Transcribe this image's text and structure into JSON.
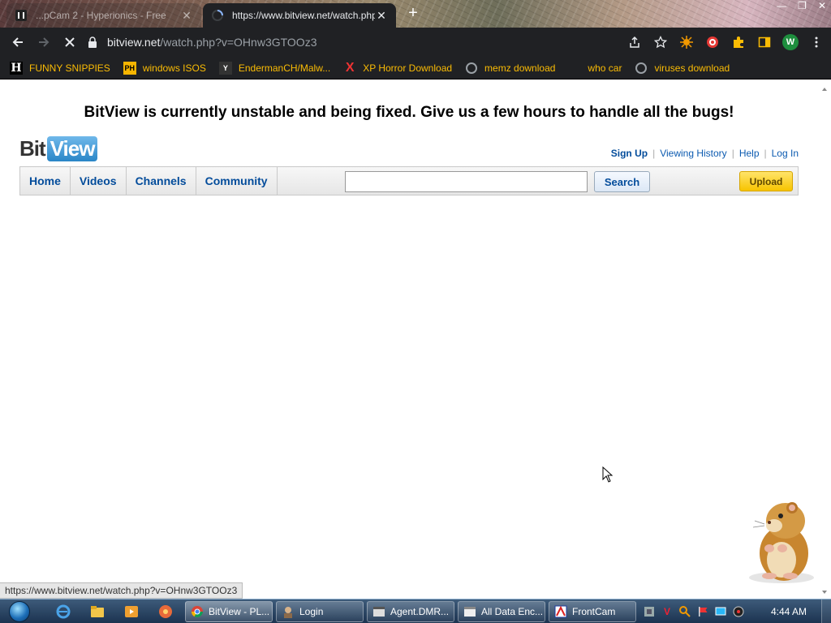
{
  "browser": {
    "tabs": [
      {
        "title": "...pCam 2 - Hyperionics - Free"
      },
      {
        "title": "https://www.bitview.net/watch.php"
      }
    ],
    "new_tab_symbol": "+",
    "window_controls": {
      "minimize": "—",
      "maximize": "❐",
      "close": "✕"
    },
    "url_host": "bitview.net",
    "url_path": "/watch.php?v=OHnw3GTOOz3",
    "profile_initial": "W",
    "bookmarks": [
      {
        "label": "FUNNY SNIPPIES",
        "icon": "H"
      },
      {
        "label": "windows ISOS",
        "icon": "PH"
      },
      {
        "label": "EndermanCH/Malw...",
        "icon": "Y"
      },
      {
        "label": "XP Horror Download",
        "icon": "X"
      },
      {
        "label": "memz download",
        "icon": "globe"
      },
      {
        "label": "who car",
        "icon": ""
      },
      {
        "label": "viruses download",
        "icon": "globe"
      }
    ]
  },
  "page": {
    "banner": "BitView is currently unstable and being fixed. Give us a few hours to handle all the bugs!",
    "logo": {
      "part1": "Bit",
      "part2": "View"
    },
    "user_links": {
      "signup": "Sign Up",
      "history": "Viewing History",
      "help": "Help",
      "login": "Log In"
    },
    "nav": {
      "home": "Home",
      "videos": "Videos",
      "channels": "Channels",
      "community": "Community"
    },
    "search": {
      "value": "",
      "button": "Search"
    },
    "upload_button": "Upload",
    "status_url": "https://www.bitview.net/watch.php?v=OHnw3GTOOz3"
  },
  "taskbar": {
    "tasks": [
      {
        "label": "BitView - PL..."
      },
      {
        "label": "Login"
      },
      {
        "label": "Agent.DMR..."
      },
      {
        "label": "All Data Enc..."
      },
      {
        "label": "FrontCam"
      }
    ],
    "clock": "4:44 AM"
  },
  "colors": {
    "link_blue": "#034c9b",
    "bookmark_text": "#fbbc04",
    "chrome_dark": "#202124",
    "upload_yellow": "#f7c400"
  }
}
